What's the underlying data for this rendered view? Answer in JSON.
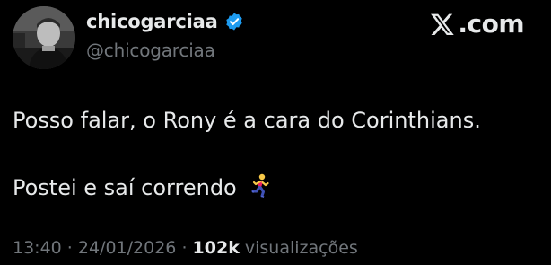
{
  "author": {
    "display_name": "chicogarciaa",
    "handle": "@chicogarciaa",
    "verified": true,
    "avatar_icon": "person-photo-avatar"
  },
  "brand": {
    "logo_icon": "x-logo-icon",
    "text": ".com"
  },
  "tweet": {
    "line_1": "Posso falar, o Rony é a cara do Corinthians.",
    "line_2": "Postei e saí correndo",
    "line_2_emoji_icon": "person-running-icon"
  },
  "meta": {
    "time": "13:40",
    "separator_1": " · ",
    "date": "24/01/2026",
    "separator_2": " · ",
    "views_count": "102k",
    "views_label": " visualizações"
  },
  "colors": {
    "background": "#000000",
    "text_primary": "#e7e9ea",
    "text_secondary": "#71767b",
    "verified_blue": "#1d9bf0"
  }
}
